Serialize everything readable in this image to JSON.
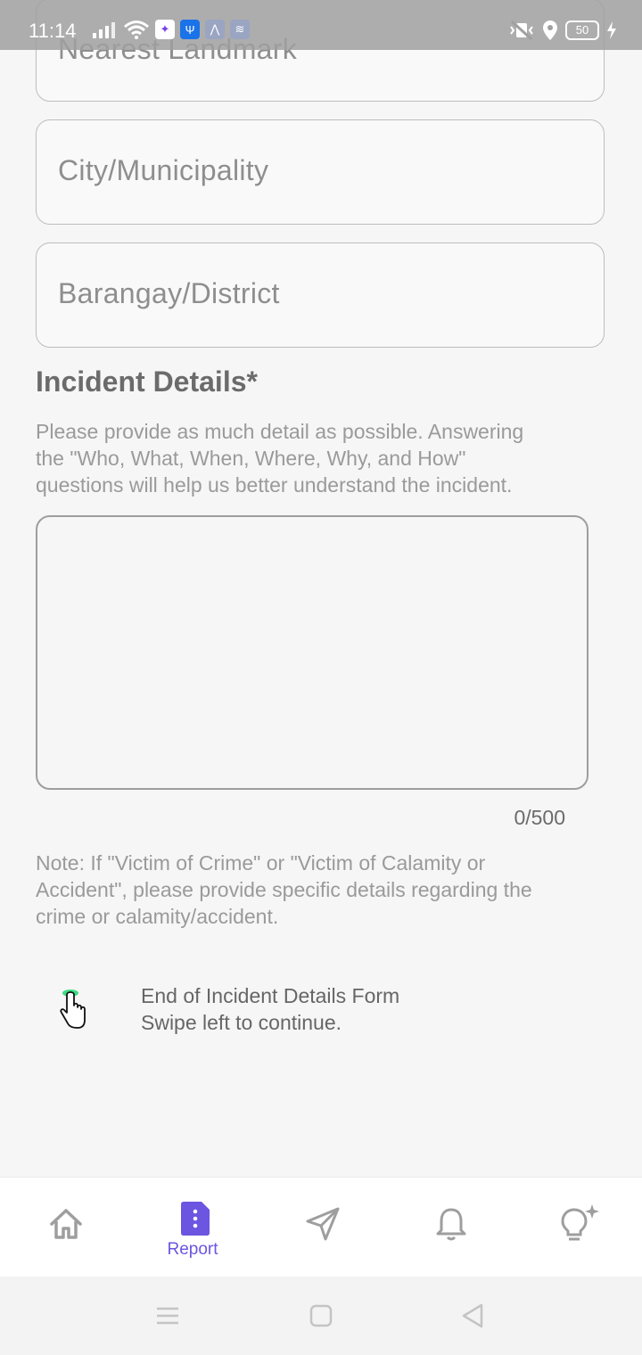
{
  "status_bar": {
    "time": "11:14",
    "battery": "50"
  },
  "form": {
    "nearest_landmark_placeholder": "Nearest Landmark",
    "city_placeholder": "City/Municipality",
    "barangay_placeholder": "Barangay/District",
    "incident_title": "Incident Details*",
    "incident_help_line1": "Please provide as much detail as possible. Answering",
    "incident_help_line2": "the \"Who, What, When, Where, Why, and How\"",
    "incident_help_line3": "questions will help us better understand the incident.",
    "details_value": "",
    "counter": "0/500",
    "note_line1": "Note: If \"Victim of Crime\" or \"Victim of Calamity or",
    "note_line2": "Accident\", please provide specific details regarding the",
    "note_line3": "crime or calamity/accident.",
    "end_line1": "End of Incident Details Form",
    "end_line2": "Swipe left to continue."
  },
  "bottom_nav": {
    "items": [
      {
        "icon": "home-icon",
        "label": ""
      },
      {
        "icon": "report-icon",
        "label": "Report"
      },
      {
        "icon": "send-icon",
        "label": ""
      },
      {
        "icon": "bell-icon",
        "label": ""
      },
      {
        "icon": "bulb-icon",
        "label": ""
      }
    ],
    "active_color": "#6c55e0",
    "inactive_color": "#9e9e9e"
  },
  "system_nav": {
    "icons": [
      "menu-icon",
      "home-square-icon",
      "back-icon"
    ]
  }
}
